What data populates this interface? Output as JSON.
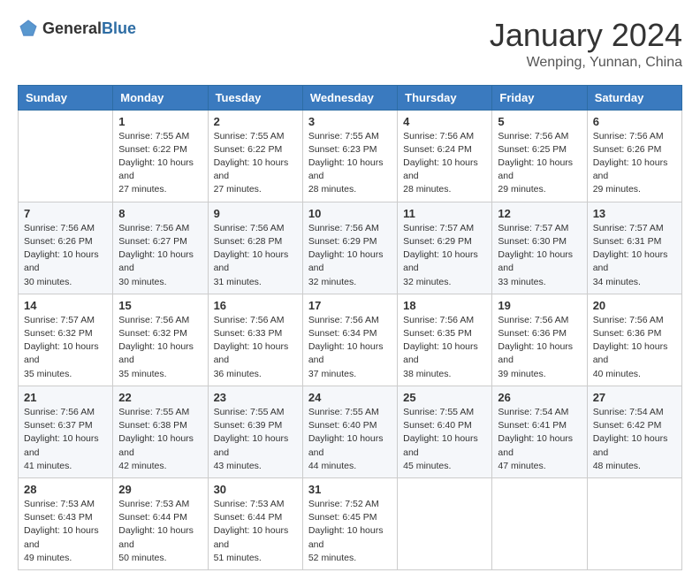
{
  "header": {
    "logo_general": "General",
    "logo_blue": "Blue",
    "month": "January 2024",
    "location": "Wenping, Yunnan, China"
  },
  "weekdays": [
    "Sunday",
    "Monday",
    "Tuesday",
    "Wednesday",
    "Thursday",
    "Friday",
    "Saturday"
  ],
  "weeks": [
    [
      {
        "day": "",
        "sunrise": "",
        "sunset": "",
        "daylight": ""
      },
      {
        "day": "1",
        "sunrise": "Sunrise: 7:55 AM",
        "sunset": "Sunset: 6:22 PM",
        "daylight": "Daylight: 10 hours and 27 minutes."
      },
      {
        "day": "2",
        "sunrise": "Sunrise: 7:55 AM",
        "sunset": "Sunset: 6:22 PM",
        "daylight": "Daylight: 10 hours and 27 minutes."
      },
      {
        "day": "3",
        "sunrise": "Sunrise: 7:55 AM",
        "sunset": "Sunset: 6:23 PM",
        "daylight": "Daylight: 10 hours and 28 minutes."
      },
      {
        "day": "4",
        "sunrise": "Sunrise: 7:56 AM",
        "sunset": "Sunset: 6:24 PM",
        "daylight": "Daylight: 10 hours and 28 minutes."
      },
      {
        "day": "5",
        "sunrise": "Sunrise: 7:56 AM",
        "sunset": "Sunset: 6:25 PM",
        "daylight": "Daylight: 10 hours and 29 minutes."
      },
      {
        "day": "6",
        "sunrise": "Sunrise: 7:56 AM",
        "sunset": "Sunset: 6:26 PM",
        "daylight": "Daylight: 10 hours and 29 minutes."
      }
    ],
    [
      {
        "day": "7",
        "sunrise": "Sunrise: 7:56 AM",
        "sunset": "Sunset: 6:26 PM",
        "daylight": "Daylight: 10 hours and 30 minutes."
      },
      {
        "day": "8",
        "sunrise": "Sunrise: 7:56 AM",
        "sunset": "Sunset: 6:27 PM",
        "daylight": "Daylight: 10 hours and 30 minutes."
      },
      {
        "day": "9",
        "sunrise": "Sunrise: 7:56 AM",
        "sunset": "Sunset: 6:28 PM",
        "daylight": "Daylight: 10 hours and 31 minutes."
      },
      {
        "day": "10",
        "sunrise": "Sunrise: 7:56 AM",
        "sunset": "Sunset: 6:29 PM",
        "daylight": "Daylight: 10 hours and 32 minutes."
      },
      {
        "day": "11",
        "sunrise": "Sunrise: 7:57 AM",
        "sunset": "Sunset: 6:29 PM",
        "daylight": "Daylight: 10 hours and 32 minutes."
      },
      {
        "day": "12",
        "sunrise": "Sunrise: 7:57 AM",
        "sunset": "Sunset: 6:30 PM",
        "daylight": "Daylight: 10 hours and 33 minutes."
      },
      {
        "day": "13",
        "sunrise": "Sunrise: 7:57 AM",
        "sunset": "Sunset: 6:31 PM",
        "daylight": "Daylight: 10 hours and 34 minutes."
      }
    ],
    [
      {
        "day": "14",
        "sunrise": "Sunrise: 7:57 AM",
        "sunset": "Sunset: 6:32 PM",
        "daylight": "Daylight: 10 hours and 35 minutes."
      },
      {
        "day": "15",
        "sunrise": "Sunrise: 7:56 AM",
        "sunset": "Sunset: 6:32 PM",
        "daylight": "Daylight: 10 hours and 35 minutes."
      },
      {
        "day": "16",
        "sunrise": "Sunrise: 7:56 AM",
        "sunset": "Sunset: 6:33 PM",
        "daylight": "Daylight: 10 hours and 36 minutes."
      },
      {
        "day": "17",
        "sunrise": "Sunrise: 7:56 AM",
        "sunset": "Sunset: 6:34 PM",
        "daylight": "Daylight: 10 hours and 37 minutes."
      },
      {
        "day": "18",
        "sunrise": "Sunrise: 7:56 AM",
        "sunset": "Sunset: 6:35 PM",
        "daylight": "Daylight: 10 hours and 38 minutes."
      },
      {
        "day": "19",
        "sunrise": "Sunrise: 7:56 AM",
        "sunset": "Sunset: 6:36 PM",
        "daylight": "Daylight: 10 hours and 39 minutes."
      },
      {
        "day": "20",
        "sunrise": "Sunrise: 7:56 AM",
        "sunset": "Sunset: 6:36 PM",
        "daylight": "Daylight: 10 hours and 40 minutes."
      }
    ],
    [
      {
        "day": "21",
        "sunrise": "Sunrise: 7:56 AM",
        "sunset": "Sunset: 6:37 PM",
        "daylight": "Daylight: 10 hours and 41 minutes."
      },
      {
        "day": "22",
        "sunrise": "Sunrise: 7:55 AM",
        "sunset": "Sunset: 6:38 PM",
        "daylight": "Daylight: 10 hours and 42 minutes."
      },
      {
        "day": "23",
        "sunrise": "Sunrise: 7:55 AM",
        "sunset": "Sunset: 6:39 PM",
        "daylight": "Daylight: 10 hours and 43 minutes."
      },
      {
        "day": "24",
        "sunrise": "Sunrise: 7:55 AM",
        "sunset": "Sunset: 6:40 PM",
        "daylight": "Daylight: 10 hours and 44 minutes."
      },
      {
        "day": "25",
        "sunrise": "Sunrise: 7:55 AM",
        "sunset": "Sunset: 6:40 PM",
        "daylight": "Daylight: 10 hours and 45 minutes."
      },
      {
        "day": "26",
        "sunrise": "Sunrise: 7:54 AM",
        "sunset": "Sunset: 6:41 PM",
        "daylight": "Daylight: 10 hours and 47 minutes."
      },
      {
        "day": "27",
        "sunrise": "Sunrise: 7:54 AM",
        "sunset": "Sunset: 6:42 PM",
        "daylight": "Daylight: 10 hours and 48 minutes."
      }
    ],
    [
      {
        "day": "28",
        "sunrise": "Sunrise: 7:53 AM",
        "sunset": "Sunset: 6:43 PM",
        "daylight": "Daylight: 10 hours and 49 minutes."
      },
      {
        "day": "29",
        "sunrise": "Sunrise: 7:53 AM",
        "sunset": "Sunset: 6:44 PM",
        "daylight": "Daylight: 10 hours and 50 minutes."
      },
      {
        "day": "30",
        "sunrise": "Sunrise: 7:53 AM",
        "sunset": "Sunset: 6:44 PM",
        "daylight": "Daylight: 10 hours and 51 minutes."
      },
      {
        "day": "31",
        "sunrise": "Sunrise: 7:52 AM",
        "sunset": "Sunset: 6:45 PM",
        "daylight": "Daylight: 10 hours and 52 minutes."
      },
      {
        "day": "",
        "sunrise": "",
        "sunset": "",
        "daylight": ""
      },
      {
        "day": "",
        "sunrise": "",
        "sunset": "",
        "daylight": ""
      },
      {
        "day": "",
        "sunrise": "",
        "sunset": "",
        "daylight": ""
      }
    ]
  ]
}
